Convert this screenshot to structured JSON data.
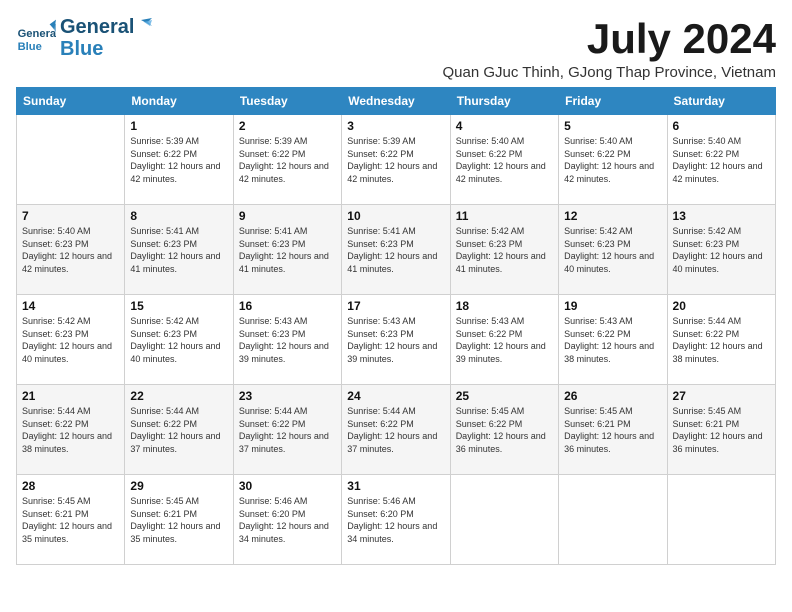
{
  "header": {
    "logo_general": "General",
    "logo_blue": "Blue",
    "month_title": "July 2024",
    "location": "Quan GJuc Thinh, GJong Thap Province, Vietnam"
  },
  "weekdays": [
    "Sunday",
    "Monday",
    "Tuesday",
    "Wednesday",
    "Thursday",
    "Friday",
    "Saturday"
  ],
  "weeks": [
    [
      {
        "day": "",
        "sunrise": "",
        "sunset": "",
        "daylight": ""
      },
      {
        "day": "1",
        "sunrise": "Sunrise: 5:39 AM",
        "sunset": "Sunset: 6:22 PM",
        "daylight": "Daylight: 12 hours and 42 minutes."
      },
      {
        "day": "2",
        "sunrise": "Sunrise: 5:39 AM",
        "sunset": "Sunset: 6:22 PM",
        "daylight": "Daylight: 12 hours and 42 minutes."
      },
      {
        "day": "3",
        "sunrise": "Sunrise: 5:39 AM",
        "sunset": "Sunset: 6:22 PM",
        "daylight": "Daylight: 12 hours and 42 minutes."
      },
      {
        "day": "4",
        "sunrise": "Sunrise: 5:40 AM",
        "sunset": "Sunset: 6:22 PM",
        "daylight": "Daylight: 12 hours and 42 minutes."
      },
      {
        "day": "5",
        "sunrise": "Sunrise: 5:40 AM",
        "sunset": "Sunset: 6:22 PM",
        "daylight": "Daylight: 12 hours and 42 minutes."
      },
      {
        "day": "6",
        "sunrise": "Sunrise: 5:40 AM",
        "sunset": "Sunset: 6:22 PM",
        "daylight": "Daylight: 12 hours and 42 minutes."
      }
    ],
    [
      {
        "day": "7",
        "sunrise": "Sunrise: 5:40 AM",
        "sunset": "Sunset: 6:23 PM",
        "daylight": "Daylight: 12 hours and 42 minutes."
      },
      {
        "day": "8",
        "sunrise": "Sunrise: 5:41 AM",
        "sunset": "Sunset: 6:23 PM",
        "daylight": "Daylight: 12 hours and 41 minutes."
      },
      {
        "day": "9",
        "sunrise": "Sunrise: 5:41 AM",
        "sunset": "Sunset: 6:23 PM",
        "daylight": "Daylight: 12 hours and 41 minutes."
      },
      {
        "day": "10",
        "sunrise": "Sunrise: 5:41 AM",
        "sunset": "Sunset: 6:23 PM",
        "daylight": "Daylight: 12 hours and 41 minutes."
      },
      {
        "day": "11",
        "sunrise": "Sunrise: 5:42 AM",
        "sunset": "Sunset: 6:23 PM",
        "daylight": "Daylight: 12 hours and 41 minutes."
      },
      {
        "day": "12",
        "sunrise": "Sunrise: 5:42 AM",
        "sunset": "Sunset: 6:23 PM",
        "daylight": "Daylight: 12 hours and 40 minutes."
      },
      {
        "day": "13",
        "sunrise": "Sunrise: 5:42 AM",
        "sunset": "Sunset: 6:23 PM",
        "daylight": "Daylight: 12 hours and 40 minutes."
      }
    ],
    [
      {
        "day": "14",
        "sunrise": "Sunrise: 5:42 AM",
        "sunset": "Sunset: 6:23 PM",
        "daylight": "Daylight: 12 hours and 40 minutes."
      },
      {
        "day": "15",
        "sunrise": "Sunrise: 5:42 AM",
        "sunset": "Sunset: 6:23 PM",
        "daylight": "Daylight: 12 hours and 40 minutes."
      },
      {
        "day": "16",
        "sunrise": "Sunrise: 5:43 AM",
        "sunset": "Sunset: 6:23 PM",
        "daylight": "Daylight: 12 hours and 39 minutes."
      },
      {
        "day": "17",
        "sunrise": "Sunrise: 5:43 AM",
        "sunset": "Sunset: 6:23 PM",
        "daylight": "Daylight: 12 hours and 39 minutes."
      },
      {
        "day": "18",
        "sunrise": "Sunrise: 5:43 AM",
        "sunset": "Sunset: 6:22 PM",
        "daylight": "Daylight: 12 hours and 39 minutes."
      },
      {
        "day": "19",
        "sunrise": "Sunrise: 5:43 AM",
        "sunset": "Sunset: 6:22 PM",
        "daylight": "Daylight: 12 hours and 38 minutes."
      },
      {
        "day": "20",
        "sunrise": "Sunrise: 5:44 AM",
        "sunset": "Sunset: 6:22 PM",
        "daylight": "Daylight: 12 hours and 38 minutes."
      }
    ],
    [
      {
        "day": "21",
        "sunrise": "Sunrise: 5:44 AM",
        "sunset": "Sunset: 6:22 PM",
        "daylight": "Daylight: 12 hours and 38 minutes."
      },
      {
        "day": "22",
        "sunrise": "Sunrise: 5:44 AM",
        "sunset": "Sunset: 6:22 PM",
        "daylight": "Daylight: 12 hours and 37 minutes."
      },
      {
        "day": "23",
        "sunrise": "Sunrise: 5:44 AM",
        "sunset": "Sunset: 6:22 PM",
        "daylight": "Daylight: 12 hours and 37 minutes."
      },
      {
        "day": "24",
        "sunrise": "Sunrise: 5:44 AM",
        "sunset": "Sunset: 6:22 PM",
        "daylight": "Daylight: 12 hours and 37 minutes."
      },
      {
        "day": "25",
        "sunrise": "Sunrise: 5:45 AM",
        "sunset": "Sunset: 6:22 PM",
        "daylight": "Daylight: 12 hours and 36 minutes."
      },
      {
        "day": "26",
        "sunrise": "Sunrise: 5:45 AM",
        "sunset": "Sunset: 6:21 PM",
        "daylight": "Daylight: 12 hours and 36 minutes."
      },
      {
        "day": "27",
        "sunrise": "Sunrise: 5:45 AM",
        "sunset": "Sunset: 6:21 PM",
        "daylight": "Daylight: 12 hours and 36 minutes."
      }
    ],
    [
      {
        "day": "28",
        "sunrise": "Sunrise: 5:45 AM",
        "sunset": "Sunset: 6:21 PM",
        "daylight": "Daylight: 12 hours and 35 minutes."
      },
      {
        "day": "29",
        "sunrise": "Sunrise: 5:45 AM",
        "sunset": "Sunset: 6:21 PM",
        "daylight": "Daylight: 12 hours and 35 minutes."
      },
      {
        "day": "30",
        "sunrise": "Sunrise: 5:46 AM",
        "sunset": "Sunset: 6:20 PM",
        "daylight": "Daylight: 12 hours and 34 minutes."
      },
      {
        "day": "31",
        "sunrise": "Sunrise: 5:46 AM",
        "sunset": "Sunset: 6:20 PM",
        "daylight": "Daylight: 12 hours and 34 minutes."
      },
      {
        "day": "",
        "sunrise": "",
        "sunset": "",
        "daylight": ""
      },
      {
        "day": "",
        "sunrise": "",
        "sunset": "",
        "daylight": ""
      },
      {
        "day": "",
        "sunrise": "",
        "sunset": "",
        "daylight": ""
      }
    ]
  ]
}
